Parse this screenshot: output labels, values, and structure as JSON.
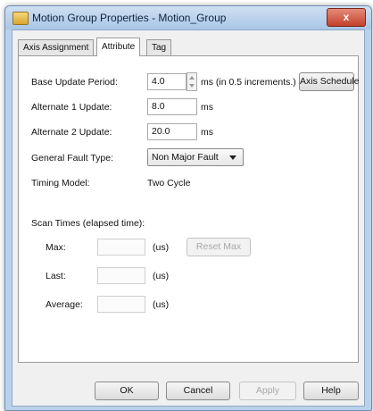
{
  "window": {
    "title": "Motion Group Properties - Motion_Group",
    "close_label": "x"
  },
  "tabs": [
    {
      "label": "Axis Assignment"
    },
    {
      "label": "Attribute",
      "active": true
    },
    {
      "label": "Tag"
    }
  ],
  "attribute": {
    "base_update_label": "Base Update Period:",
    "base_update_value": "4.0",
    "base_update_unit": "ms (in 0.5 increments.)",
    "axis_schedule_label": "Axis Schedule",
    "alt1_label": "Alternate 1 Update:",
    "alt1_value": "8.0",
    "alt1_unit": "ms",
    "alt2_label": "Alternate 2 Update:",
    "alt2_value": "20.0",
    "alt2_unit": "ms",
    "fault_label": "General Fault Type:",
    "fault_value": "Non Major Fault",
    "timing_label": "Timing Model:",
    "timing_value": "Two Cycle",
    "scan_title": "Scan Times (elapsed time):",
    "max_label": "Max:",
    "last_label": "Last:",
    "avg_label": "Average:",
    "unit_us": "(us)",
    "reset_label": "Reset Max"
  },
  "footer": {
    "ok": "OK",
    "cancel": "Cancel",
    "apply": "Apply",
    "help": "Help"
  }
}
